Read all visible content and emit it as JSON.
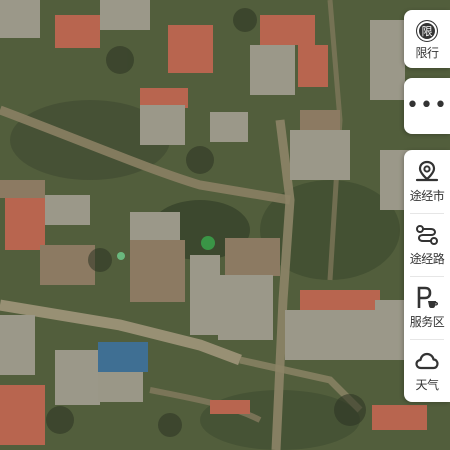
{
  "map": {
    "layer": "satellite-imagery"
  },
  "restriction": {
    "badge": "限",
    "label": "限行"
  },
  "more": {
    "glyph": "•••"
  },
  "tools": [
    {
      "label": "途经市",
      "icon": "location-pin-icon"
    },
    {
      "label": "途经路",
      "icon": "route-icon"
    },
    {
      "label": "服务区",
      "icon": "service-area-icon"
    },
    {
      "label": "天气",
      "icon": "cloud-icon"
    }
  ]
}
